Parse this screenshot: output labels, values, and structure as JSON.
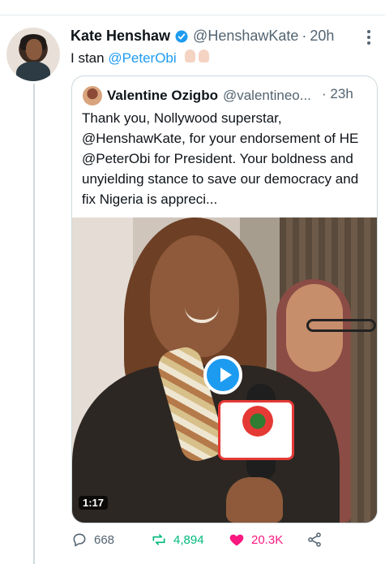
{
  "tweet": {
    "author_name": "Kate Henshaw",
    "handle": "@HenshawKate",
    "time": "20h",
    "text_prefix": "I stan ",
    "mention": "@PeterObi",
    "verified": true
  },
  "quote": {
    "author_name": "Valentine Ozigbo",
    "handle": "@valentineo...",
    "time": "23h",
    "text": "Thank you, Nollywood superstar, @HenshawKate, for your endorsement of HE @PeterObi for President. Your boldness and unyielding stance to save our democracy and fix Nigeria is appreci..."
  },
  "media": {
    "duration": "1:17"
  },
  "actions": {
    "replies": "668",
    "retweets": "4,894",
    "likes": "20.3K"
  },
  "colors": {
    "accent": "#1d9bf0",
    "retweet": "#00ba7c",
    "like": "#f91880",
    "muted": "#536471"
  },
  "icons": [
    "verified-icon",
    "more-icon",
    "play-icon",
    "reply-icon",
    "retweet-icon",
    "like-icon",
    "share-icon"
  ]
}
